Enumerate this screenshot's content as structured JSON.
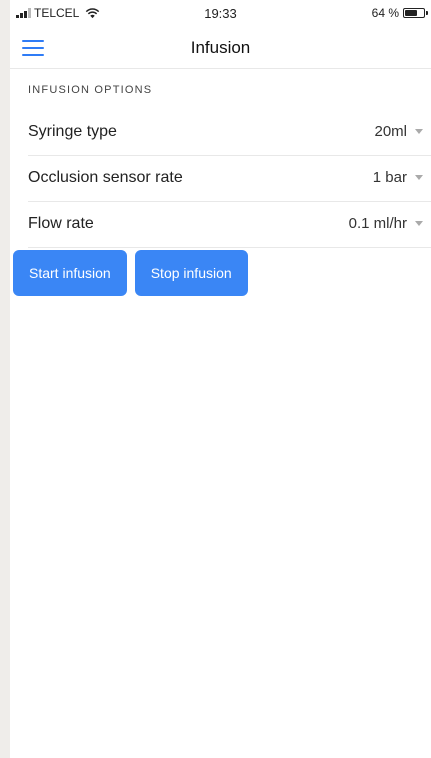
{
  "status_bar": {
    "carrier": "TELCEL",
    "time": "19:33",
    "battery": "64 %"
  },
  "nav": {
    "title": "Infusion"
  },
  "section": {
    "header": "INFUSION OPTIONS"
  },
  "options": [
    {
      "label": "Syringe type",
      "value": "20ml"
    },
    {
      "label": "Occlusion sensor rate",
      "value": "1 bar"
    },
    {
      "label": "Flow rate",
      "value": "0.1 ml/hr"
    }
  ],
  "buttons": {
    "start": "Start infusion",
    "stop": "Stop infusion"
  },
  "colors": {
    "accent": "#3a86f5",
    "menu_icon": "#2f7cf6"
  },
  "icons": {
    "menu": "hamburger-menu-icon",
    "signal": "cellular-signal-icon",
    "wifi": "wifi-icon",
    "battery": "battery-icon",
    "dropdown": "caret-down-icon"
  }
}
